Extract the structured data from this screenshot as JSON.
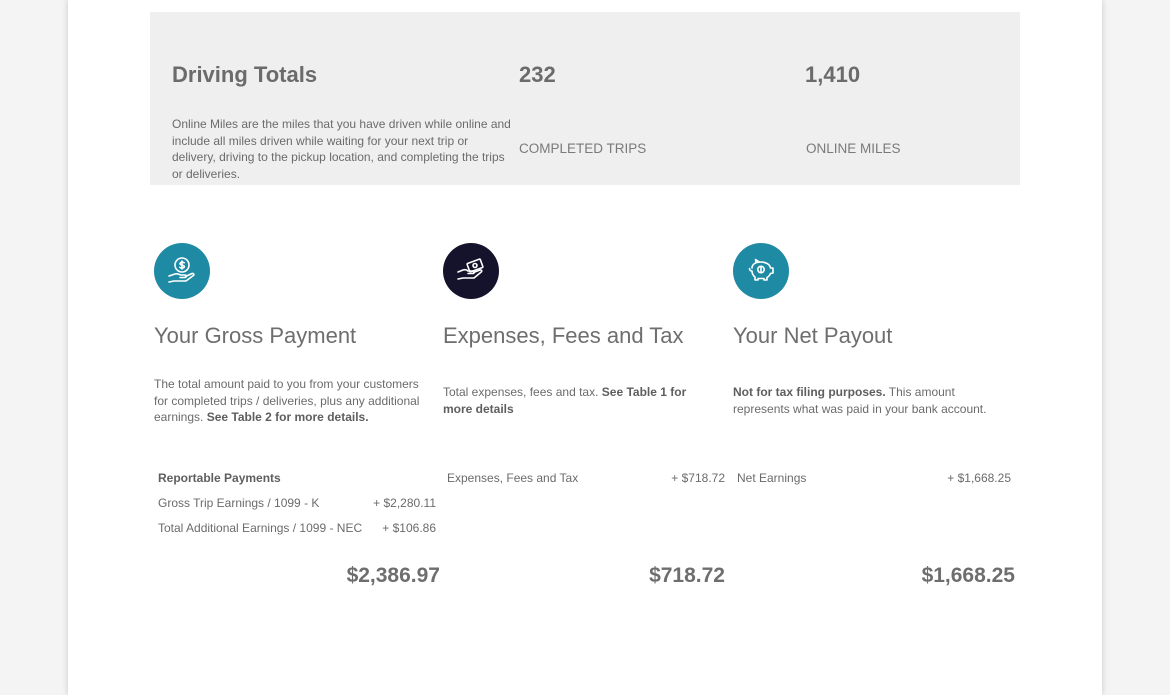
{
  "driving_totals": {
    "title": "Driving Totals",
    "description": "Online Miles are the miles that you have driven while online and include all miles driven while waiting for your next trip or delivery, driving to the pickup location, and completing the trips or deliveries.",
    "completed_trips_value": "232",
    "completed_trips_label": "COMPLETED TRIPS",
    "online_miles_value": "1,410",
    "online_miles_label": "ONLINE MILES"
  },
  "colors": {
    "gross_icon_bg": "#1f8aa3",
    "expenses_icon_bg": "#15132b",
    "net_icon_bg": "#1f8aa3"
  },
  "gross": {
    "icon": "hand-dollar-icon",
    "title": "Your Gross Payment",
    "desc_text": "The total amount paid to you from your customers for completed trips / deliveries, plus any additional earnings. ",
    "desc_bold": "See Table 2 for more details.",
    "rows_header": "Reportable Payments",
    "rows": [
      {
        "label": "Gross Trip Earnings / 1099 - K",
        "value": "+ $2,280.11"
      },
      {
        "label": "Total Additional Earnings / 1099 - NEC",
        "value": "+ $106.86"
      }
    ],
    "total": "$2,386.97"
  },
  "expenses": {
    "icon": "hand-money-icon",
    "title": "Expenses, Fees and Tax",
    "desc_text": "Total expenses, fees and tax. ",
    "desc_bold": "See Table 1 for more details",
    "rows": [
      {
        "label": "Expenses, Fees and Tax",
        "value": "+ $718.72"
      }
    ],
    "total": "$718.72"
  },
  "net": {
    "icon": "piggy-bank-icon",
    "title": "Your Net Payout",
    "desc_bold": "Not for tax filing purposes.",
    "desc_text": " This amount represents what was paid in your bank account.",
    "rows": [
      {
        "label": "Net Earnings",
        "value": "+ $1,668.25"
      }
    ],
    "total": "$1,668.25"
  }
}
